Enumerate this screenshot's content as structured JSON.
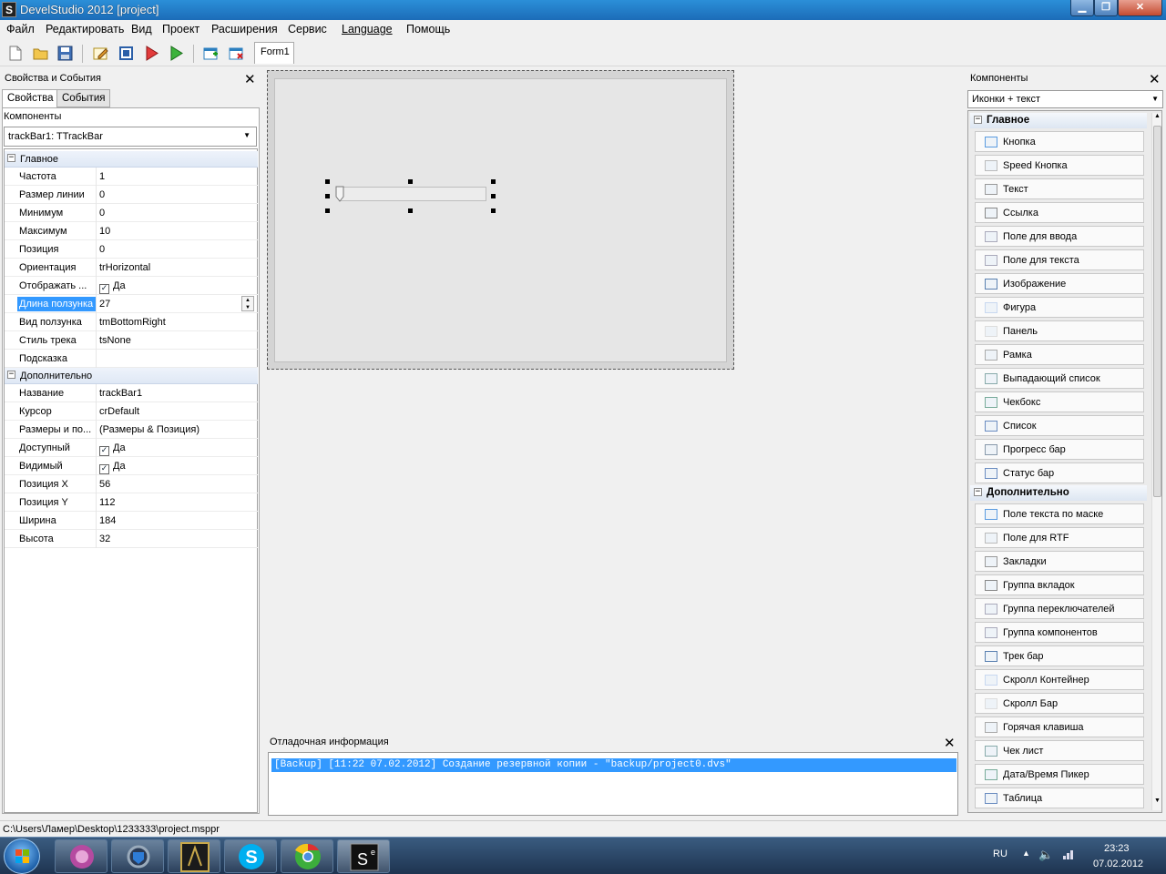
{
  "window": {
    "title": "DevelStudio 2012 [project]",
    "app_icon": "S"
  },
  "menu": [
    "Файл",
    "Редактировать",
    "Вид",
    "Проект",
    "Расширения",
    "Сервис",
    "Language",
    "Помощь"
  ],
  "form_tab": "Form1",
  "left_panel": {
    "title": "Свойства и События",
    "tabs": [
      "Свойства",
      "События"
    ],
    "components_label": "Компоненты",
    "selected_component": "trackBar1: TTrackBar",
    "groups": [
      {
        "name": "Главное",
        "rows": [
          {
            "name": "Частота",
            "value": "1"
          },
          {
            "name": "Размер линии",
            "value": "0"
          },
          {
            "name": "Минимум",
            "value": "0"
          },
          {
            "name": "Максимум",
            "value": "10"
          },
          {
            "name": "Позиция",
            "value": "0"
          },
          {
            "name": "Ориентация",
            "value": "trHorizontal"
          },
          {
            "name": "Отображать ...",
            "value": "Да",
            "check": true
          },
          {
            "name": "Длина ползунка",
            "value": "27",
            "selected": true
          },
          {
            "name": "Вид ползунка",
            "value": "tmBottomRight"
          },
          {
            "name": "Стиль трека",
            "value": "tsNone"
          },
          {
            "name": "Подсказка",
            "value": ""
          }
        ]
      },
      {
        "name": "Дополнительно",
        "rows": [
          {
            "name": "Название",
            "value": "trackBar1"
          },
          {
            "name": "Курсор",
            "value": "crDefault"
          },
          {
            "name": "Размеры и по...",
            "value": "(Размеры & Позиция)"
          },
          {
            "name": "Доступный",
            "value": "Да",
            "check": true
          },
          {
            "name": "Видимый",
            "value": "Да",
            "check": true
          },
          {
            "name": "Позиция X",
            "value": "56"
          },
          {
            "name": "Позиция Y",
            "value": "112"
          },
          {
            "name": "Ширина",
            "value": "184"
          },
          {
            "name": "Высота",
            "value": "32"
          }
        ]
      }
    ]
  },
  "debug": {
    "title": "Отладочная информация",
    "line": "[Backup] [11:22 07.02.2012] Создание резервной копии - \"backup/project0.dvs\""
  },
  "right_panel": {
    "title": "Компоненты",
    "view_mode": "Иконки + текст",
    "groups": [
      {
        "name": "Главное",
        "items": [
          "Кнопка",
          "Speed Кнопка",
          "Текст",
          "Ссылка",
          "Поле для ввода",
          "Поле для текста",
          "Изображение",
          "Фигура",
          "Панель",
          "Рамка",
          "Выпадающий список",
          "Чекбокс",
          "Список",
          "Прогресс бар",
          "Статус бар"
        ]
      },
      {
        "name": "Дополнительно",
        "items": [
          "Поле текста по маске",
          "Поле для RTF",
          "Закладки",
          "Группа вкладок",
          "Группа переключателей",
          "Группа компонентов",
          "Трек бар",
          "Скролл Контейнер",
          "Скролл Бар",
          "Горячая клавиша",
          "Чек лист",
          "Дата/Время Пикер",
          "Таблица"
        ]
      }
    ]
  },
  "statusbar": {
    "path": "C:\\Users\\Ламер\\Desktop\\1233333\\project.msppr"
  },
  "taskbar": {
    "lang": "RU",
    "time": "23:23",
    "date": "07.02.2012"
  }
}
